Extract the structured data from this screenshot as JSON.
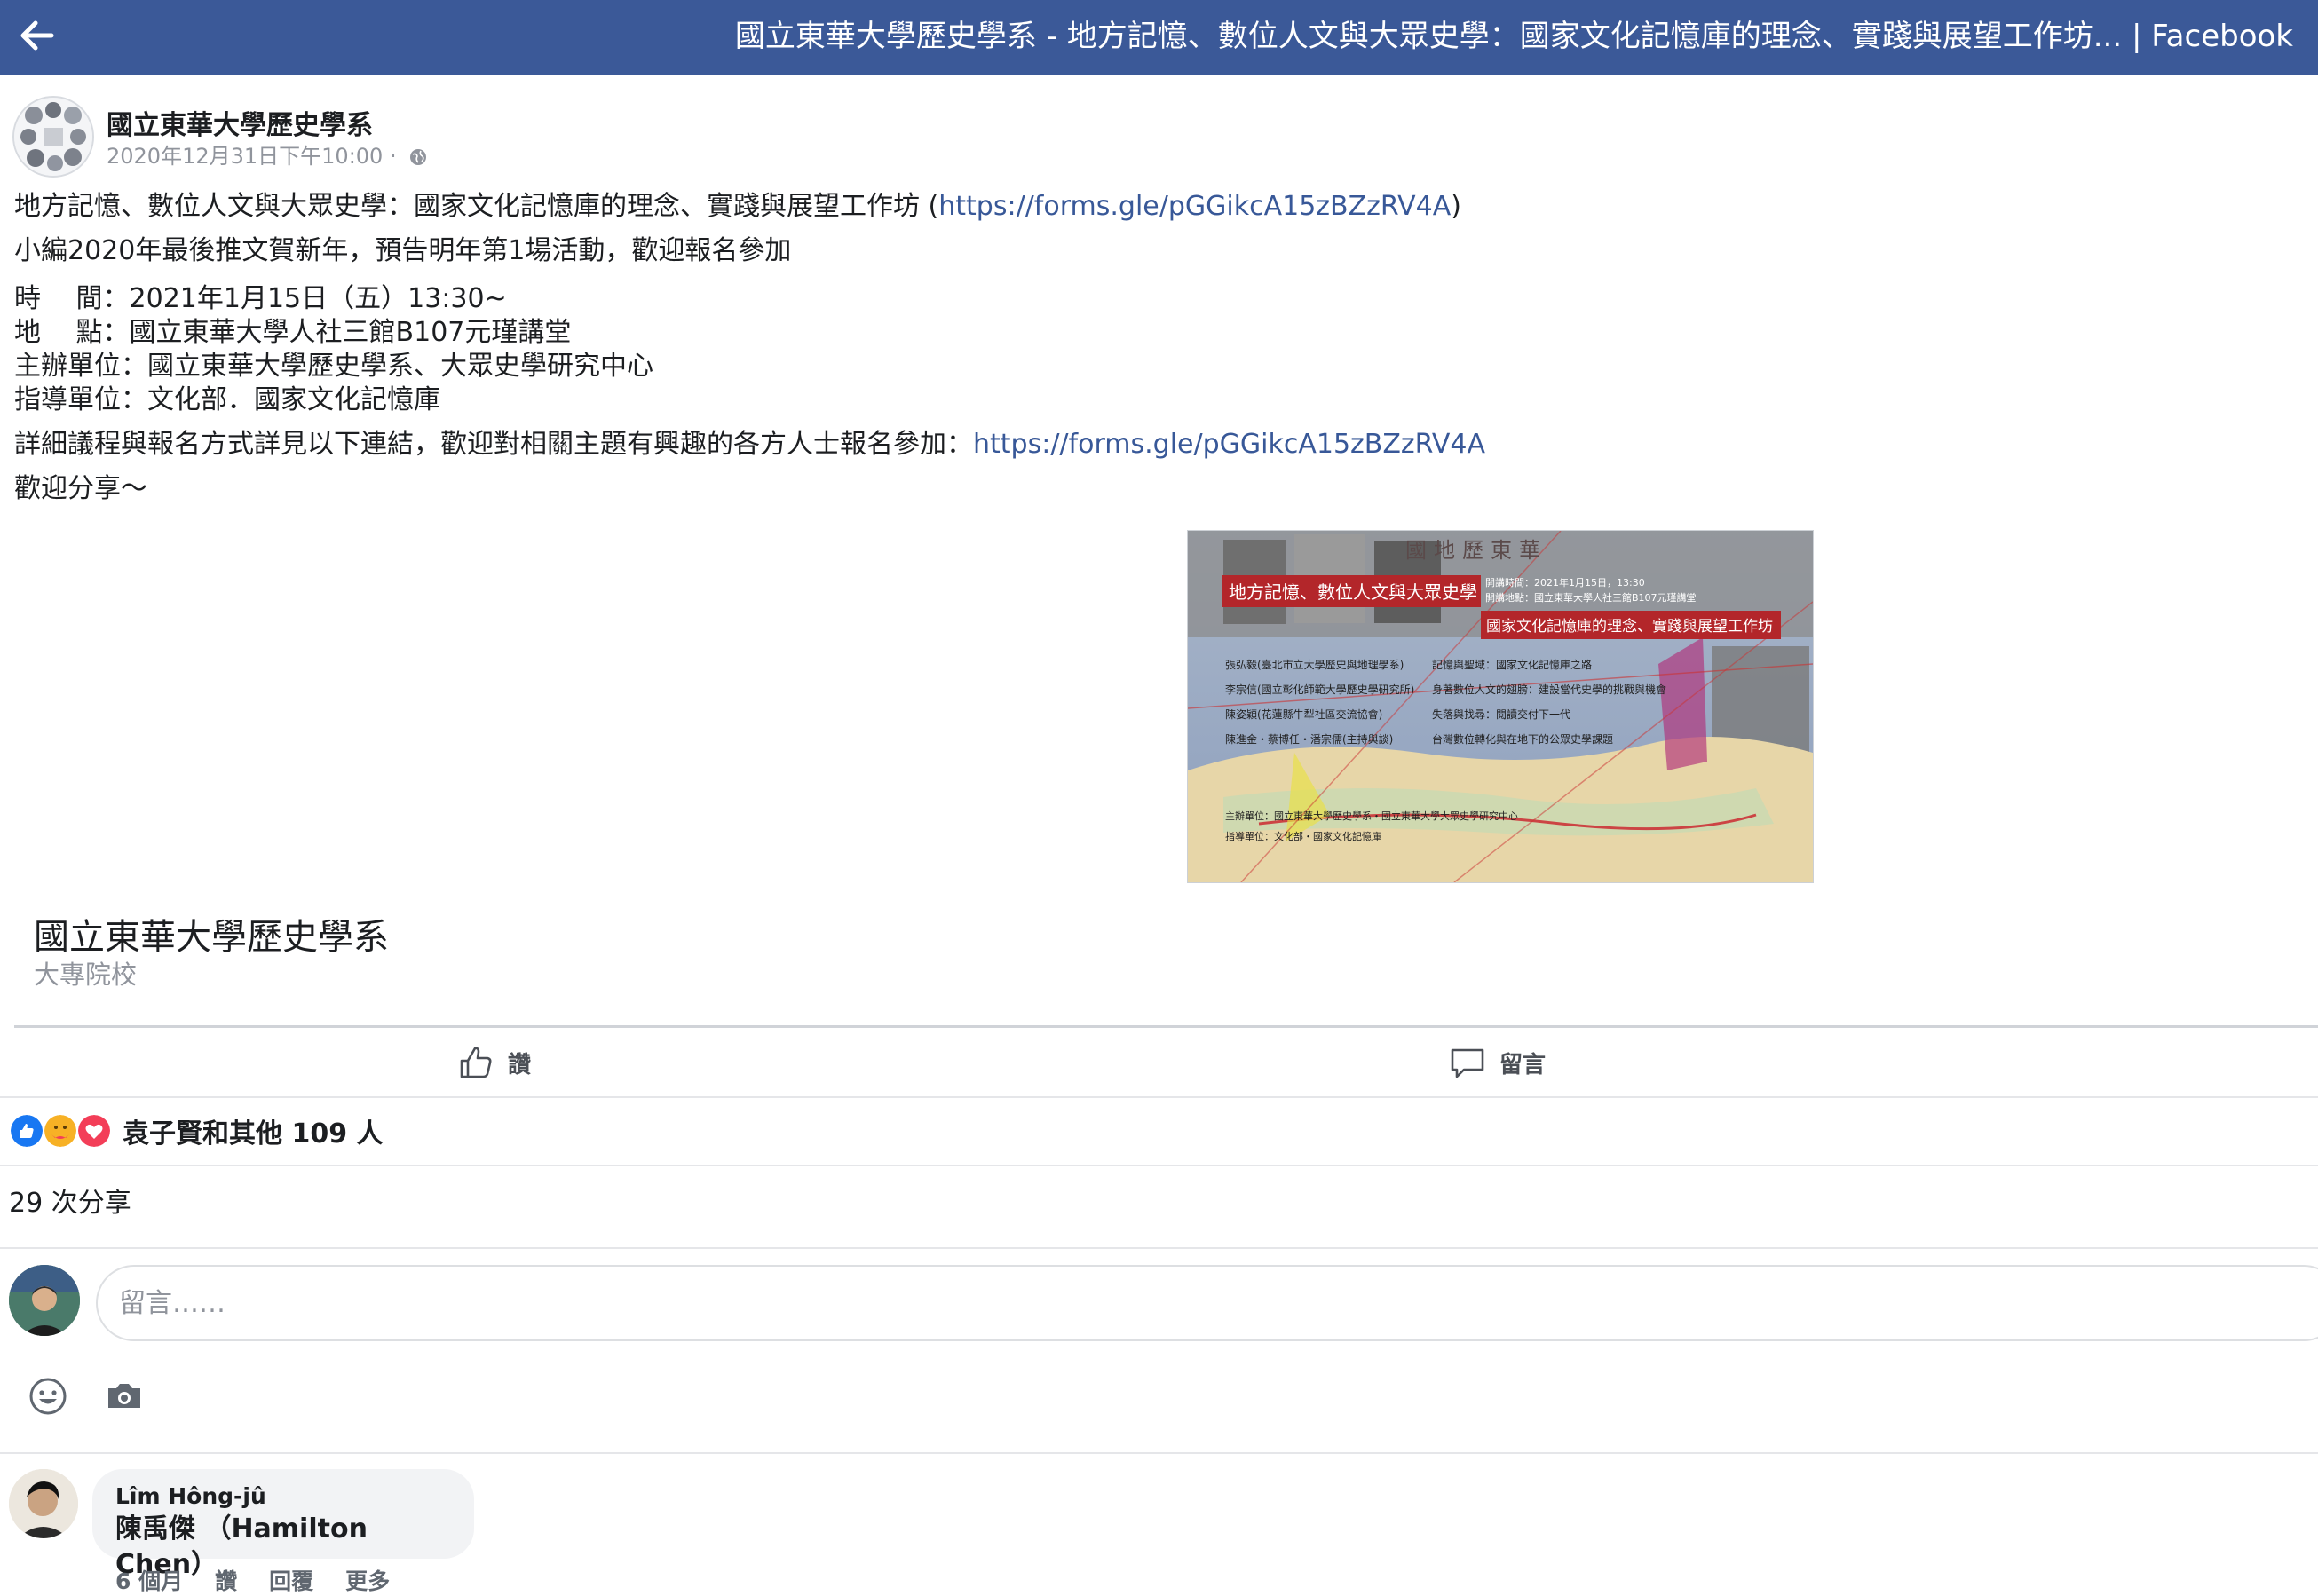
{
  "topbar": {
    "title": "國立東華大學歷史學系 - 地方記憶、數位人文與大眾史學：國家文化記憶庫的理念、實踐與展望工作坊... | Facebook",
    "color": "#3b5998"
  },
  "post": {
    "page_name": "國立東華大學歷史學系",
    "timestamp": "2020年12月31日下午10:00 ·",
    "line1_text": "地方記憶、數位人文與大眾史學：國家文化記憶庫的理念、實踐與展望工作坊 (",
    "line1_link": "https://forms.gle/pGGikcA15zBZzRV4A",
    "line1_close": ")",
    "line2": "小編2020年最後推文賀新年，預告明年第1場活動，歡迎報名參加",
    "time_line": "時　 間：2021年1月15日（五）13:30~",
    "place_line": "地　 點：國立東華大學人社三館B107元瑾講堂",
    "organizer_line": "主辦單位：國立東華大學歷史學系、大眾史學研究中心",
    "advisor_line": "指導單位：文化部．國家文化記憶庫",
    "detail_text": "詳細議程與報名方式詳見以下連結，歡迎對相關主題有興趣的各方人士報名參加：",
    "detail_link": "https://forms.gle/pGGikcA15zBZzRV4A",
    "share_line": "歡迎分享～"
  },
  "event_image": {
    "title_main": "地方記憶、數位人文與大眾史學",
    "title_sub": "國家文化記憶庫的理念、實踐與展望工作坊",
    "date": "開講時間：2021年1月15日，13:30",
    "venue": "開講地點：國立東華大學人社三館B107元瑾講堂",
    "seal": "國地歷東華",
    "speakers": [
      "張弘毅(臺北市立大學歷史與地理學系)",
      "李宗信(國立彰化師範大學歷史學研究所)",
      "陳姿穎(花蓮縣牛犁社區交流協會)",
      "陳進金・蔡博任・潘宗儒(主持與談)"
    ],
    "topics": [
      "記憶與聖域：國家文化記憶庫之路",
      "身著數位人文的翅膀：建設當代史學的挑戰與機會",
      "失落與找尋：閱讀交付下一代",
      "台灣數位轉化與在地下的公眾史學課題"
    ],
    "organizer": "主辦單位：國立東華大學歷史學系・國立東華大學大眾史學研究中心",
    "advisor": "指導單位：文化部・國家文化記憶庫"
  },
  "page_card": {
    "name": "國立東華大學歷史學系",
    "category": "大專院校"
  },
  "actions": {
    "like_label": "讚",
    "comment_label": "留言"
  },
  "reactions": {
    "summary": "袁子賢和其他 109 人"
  },
  "shares": "29 次分享",
  "composer": {
    "placeholder": "留言……"
  },
  "comment": {
    "author": "Lîm Hông-jû",
    "text": "陳禹傑 （Hamilton Chen）",
    "age": "6 個月",
    "like": "讚",
    "reply": "回覆",
    "more": "更多"
  },
  "colors": {
    "link": "#385898",
    "like_blue": "#1877f2",
    "love_red": "#f33e58",
    "care_yellow": "#f7b125"
  }
}
